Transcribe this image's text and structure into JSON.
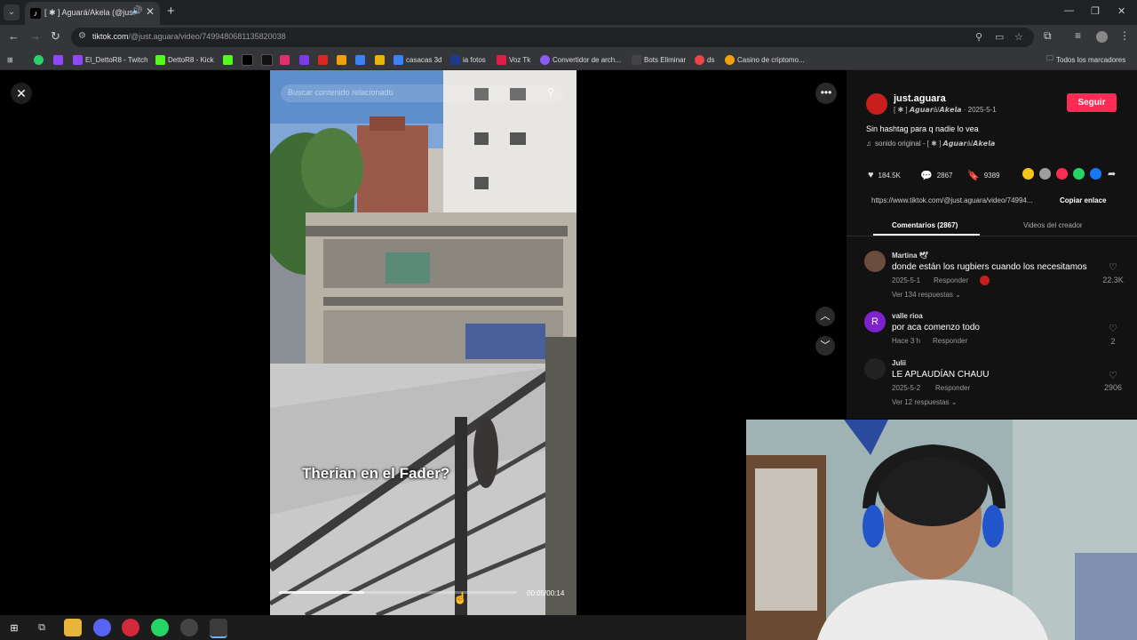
{
  "browser": {
    "tab_title": "[ ✱ ] Aguará/Akela (@just",
    "url_domain": "tiktok.com",
    "url_path": "/@just.aguara/video/7499480681135820038",
    "bookmarks": [
      {
        "label": "El_DettoR8 - Twitch",
        "color": "#9146ff"
      },
      {
        "label": "DettoR8 - Kick",
        "color": "#53fc18"
      },
      {
        "label": "casacas 3d",
        "color": "#3b82f6"
      },
      {
        "label": "ia fotos",
        "color": "#1e3a8a"
      },
      {
        "label": "Voz Tk",
        "color": "#e11d48"
      },
      {
        "label": "Convertidor de arch...",
        "color": "#8b5cf6"
      },
      {
        "label": "Bots Eliminar",
        "color": "#444444"
      },
      {
        "label": "ds",
        "color": "#ef4444"
      },
      {
        "label": "Casino de criptomo...",
        "color": "#f59e0b"
      }
    ],
    "all_bookmarks": "Todos los marcadores"
  },
  "video": {
    "search_placeholder": "Buscar contenido relacionado",
    "caption": "Therian en el Fader?",
    "time": "00:05/00:14",
    "progress": 0.36
  },
  "post": {
    "username": "just.aguara",
    "display_line": "[ ✱ ] 𝘼𝙜𝙪𝙖𝙧á/𝘼𝙠𝙚𝙡𝙖 · 2025-5-1",
    "follow_label": "Seguir",
    "description": "Sin hashtag para q nadie lo vea",
    "sound": "sonido original - [ ✱ ] 𝘼𝙜𝙪𝙖𝙧á/𝘼𝙠𝙚𝙡𝙖",
    "likes": "184.5K",
    "comments": "2867",
    "saves": "9389",
    "link": "https://www.tiktok.com/@just.aguara/video/74994...",
    "copy_label": "Copiar enlace",
    "tab_comments": "Comentarios (2867)",
    "tab_creator": "Videos del creador"
  },
  "comments": [
    {
      "name": "Martina 🕊",
      "text": "donde están los rugbiers cuando los necesitamos",
      "date": "2025-5-1",
      "reply": "Responder",
      "likes": "22.3K",
      "view_replies": "Ver 134 respuestas ⌄"
    },
    {
      "name": "valle rioa",
      "text": "por aca comenzo todo",
      "date": "Hace 3 h",
      "reply": "Responder",
      "likes": "2",
      "avatar_letter": "R"
    },
    {
      "name": "Julii",
      "text": "LE APLAUDÍAN CHAUU",
      "date": "2025-5-2",
      "reply": "Responder",
      "likes": "2906",
      "view_replies": "Ver 12 respuestas ⌄"
    }
  ],
  "colors": {
    "accent": "#fe2c55",
    "panel_bg": "#121212",
    "share_colors": [
      "#f5c518",
      "#9e9e9e",
      "#fe2c55",
      "#25d366",
      "#1877f2"
    ]
  }
}
